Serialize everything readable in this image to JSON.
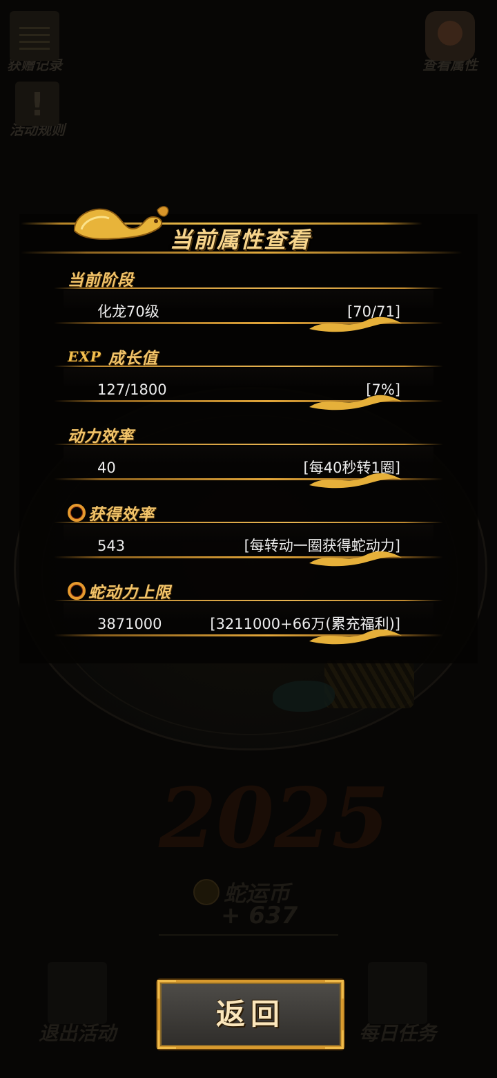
{
  "top_buttons": {
    "gift_record": "获赠记录",
    "activity_rules": "活动规则",
    "view_attributes": "查看属性"
  },
  "background": {
    "logo_text": "2025",
    "coin_label": "蛇运币",
    "coin_amount": "+ 637"
  },
  "bottom_buttons": {
    "exit_activity": "退出活动",
    "daily_task": "每日任务"
  },
  "panel": {
    "title": "当前属性查看",
    "sections": [
      {
        "label": "当前阶段",
        "icon": "none",
        "value": "化龙70级",
        "desc": "[70/71]"
      },
      {
        "label": "成长值",
        "icon": "exp-icon",
        "icon_text": "EXP",
        "value": "127/1800",
        "desc": "[7%]"
      },
      {
        "label": "动力效率",
        "icon": "none",
        "value": "40",
        "desc": "[每40秒转1圈]"
      },
      {
        "label": "获得效率",
        "icon": "ring-icon",
        "value": "543",
        "desc": "[每转动一圈获得蛇动力]"
      },
      {
        "label": "蛇动力上限",
        "icon": "ring-icon",
        "value": "3871000",
        "desc": "[3211000+66万(累充福利)]"
      }
    ]
  },
  "back_button": {
    "label": "返回"
  },
  "colors": {
    "gold": "#f2c46a",
    "gold_line": "#e8b552",
    "value_text": "#ececec",
    "background": "#070605"
  }
}
